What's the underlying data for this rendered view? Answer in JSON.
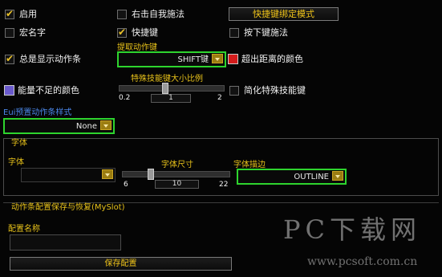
{
  "row1": {
    "enable": "启用",
    "right_self_cast": "右击自我施法",
    "keybind_mode_button": "快捷键绑定模式"
  },
  "row2": {
    "macro_name": "宏名字",
    "hotkey": "快捷键",
    "key_down_cast": "按下键施法"
  },
  "row3": {
    "always_show_actionbar": "总是显示动作条",
    "pick_actionkey_label": "提取动作键",
    "pick_actionkey_value": "SHIFT键",
    "out_of_range_color": "超出距离的颜色"
  },
  "row4": {
    "low_power_color": "能量不足的颜色",
    "special_key_scale_label": "特殊技能键大小比例",
    "slider_min": "0.2",
    "slider_value": "1",
    "slider_max": "2",
    "simplify_special_keys": "简化特殊技能键"
  },
  "preset_style": {
    "label": "Eui预置动作条样式",
    "value": "None"
  },
  "font_section": {
    "title": "字体",
    "font_label": "字体",
    "size_label": "字体尺寸",
    "size_min": "6",
    "size_value": "10",
    "size_max": "22",
    "outline_label": "字体描边",
    "outline_value": "OUTLINE"
  },
  "myslot": {
    "title": "动作条配置保存与恢复(MySlot)",
    "config_name_label": "配置名称",
    "save_button": "保存配置"
  },
  "watermark": {
    "brand": "PC下载网",
    "url": "www.pcsoft.com.cn"
  },
  "states": {
    "enable": true,
    "right_self_cast": false,
    "macro_name": false,
    "hotkey": true,
    "key_down_cast": false,
    "always_show_actionbar": true,
    "simplify_special_keys": false,
    "special_key_scale_value": 1,
    "special_key_scale_range": [
      0.2,
      2
    ],
    "font_size_value": 10,
    "font_size_range": [
      6,
      22
    ]
  },
  "colors": {
    "out_of_range": "#d41c1c",
    "low_power": "#6a5acd",
    "label_gold": "#e8c21a",
    "highlight_green": "#2ed42e",
    "preset_label_blue": "#4a86e8"
  }
}
